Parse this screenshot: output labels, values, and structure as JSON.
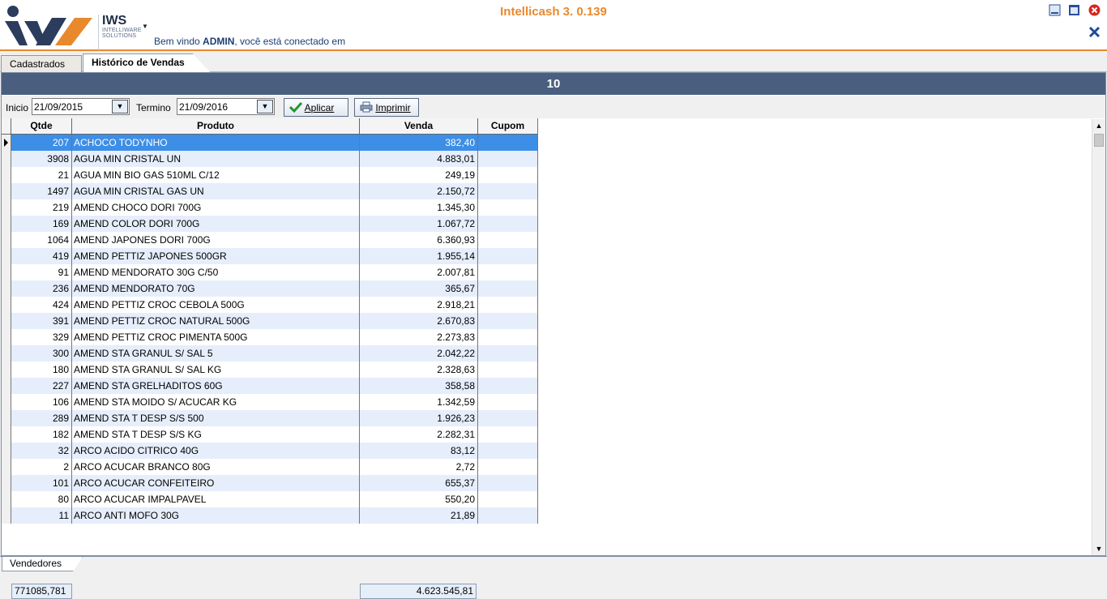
{
  "app": {
    "title": "Intellicash 3. 0.139",
    "brand": "IWS",
    "brand_sub1": "INTELLIWARE",
    "brand_sub2": "SOLUTIONS",
    "welcome_prefix": "Bem vindo ",
    "welcome_user": "ADMIN",
    "welcome_suffix": ", você está conectado em"
  },
  "tabs": [
    "Cadastrados",
    "Histórico de Vendas"
  ],
  "bottom_tab": "Vendedores",
  "banner": "10",
  "filter": {
    "inicio_label": "Inicio",
    "inicio_value": "21/09/2015",
    "termino_label": "Termino",
    "termino_value": "21/09/2016",
    "apply_label": "Aplicar",
    "print_label": "Imprimir"
  },
  "grid": {
    "columns": [
      "Qtde",
      "Produto",
      "Venda",
      "Cupom"
    ],
    "rows": [
      {
        "qtde": "207",
        "produto": "ACHOCO TODYNHO",
        "venda": "382,40",
        "cupom": ""
      },
      {
        "qtde": "3908",
        "produto": "AGUA MIN CRISTAL UN",
        "venda": "4.883,01",
        "cupom": ""
      },
      {
        "qtde": "21",
        "produto": "AGUA MIN BIO GAS 510ML C/12",
        "venda": "249,19",
        "cupom": ""
      },
      {
        "qtde": "1497",
        "produto": "AGUA MIN CRISTAL GAS UN",
        "venda": "2.150,72",
        "cupom": ""
      },
      {
        "qtde": "219",
        "produto": "AMEND CHOCO DORI 700G",
        "venda": "1.345,30",
        "cupom": ""
      },
      {
        "qtde": "169",
        "produto": "AMEND COLOR DORI 700G",
        "venda": "1.067,72",
        "cupom": ""
      },
      {
        "qtde": "1064",
        "produto": "AMEND JAPONES DORI 700G",
        "venda": "6.360,93",
        "cupom": ""
      },
      {
        "qtde": "419",
        "produto": "AMEND PETTIZ JAPONES 500GR",
        "venda": "1.955,14",
        "cupom": ""
      },
      {
        "qtde": "91",
        "produto": "AMEND MENDORATO 30G C/50",
        "venda": "2.007,81",
        "cupom": ""
      },
      {
        "qtde": "236",
        "produto": "AMEND MENDORATO 70G",
        "venda": "365,67",
        "cupom": ""
      },
      {
        "qtde": "424",
        "produto": "AMEND PETTIZ CROC CEBOLA 500G",
        "venda": "2.918,21",
        "cupom": ""
      },
      {
        "qtde": "391",
        "produto": "AMEND PETTIZ CROC NATURAL 500G",
        "venda": "2.670,83",
        "cupom": ""
      },
      {
        "qtde": "329",
        "produto": "AMEND PETTIZ CROC PIMENTA 500G",
        "venda": "2.273,83",
        "cupom": ""
      },
      {
        "qtde": "300",
        "produto": "AMEND STA GRANUL S/ SAL 5",
        "venda": "2.042,22",
        "cupom": ""
      },
      {
        "qtde": "180",
        "produto": "AMEND STA GRANUL S/ SAL KG",
        "venda": "2.328,63",
        "cupom": ""
      },
      {
        "qtde": "227",
        "produto": "AMEND STA GRELHADITOS 60G",
        "venda": "358,58",
        "cupom": ""
      },
      {
        "qtde": "106",
        "produto": "AMEND STA MOIDO S/ ACUCAR KG",
        "venda": "1.342,59",
        "cupom": ""
      },
      {
        "qtde": "289",
        "produto": "AMEND STA T DESP S/S 500",
        "venda": "1.926,23",
        "cupom": ""
      },
      {
        "qtde": "182",
        "produto": "AMEND STA T DESP S/S KG",
        "venda": "2.282,31",
        "cupom": ""
      },
      {
        "qtde": "32",
        "produto": "ARCO ACIDO CITRICO 40G",
        "venda": "83,12",
        "cupom": ""
      },
      {
        "qtde": "2",
        "produto": "ARCO ACUCAR BRANCO 80G",
        "venda": "2,72",
        "cupom": ""
      },
      {
        "qtde": "101",
        "produto": "ARCO ACUCAR CONFEITEIRO",
        "venda": "655,37",
        "cupom": ""
      },
      {
        "qtde": "80",
        "produto": "ARCO ACUCAR IMPALPAVEL",
        "venda": "550,20",
        "cupom": ""
      },
      {
        "qtde": "11",
        "produto": "ARCO ANTI MOFO 30G",
        "venda": "21,89",
        "cupom": ""
      }
    ],
    "total_qtde": "771085,781",
    "total_venda": "4.623.545,81",
    "selected_row": 0
  },
  "colors": {
    "accent": "#e8892c",
    "banner": "#4a5f7f",
    "selection": "#3d8ee6",
    "alt_row": "#e6eefc"
  },
  "icons": [
    "iws-logo",
    "menu-caret-icon",
    "minimize-icon",
    "maximize-icon",
    "close-icon",
    "close-x-icon",
    "calendar-dropdown-icon",
    "checkmark-icon",
    "printer-icon",
    "row-indicator-icon"
  ]
}
